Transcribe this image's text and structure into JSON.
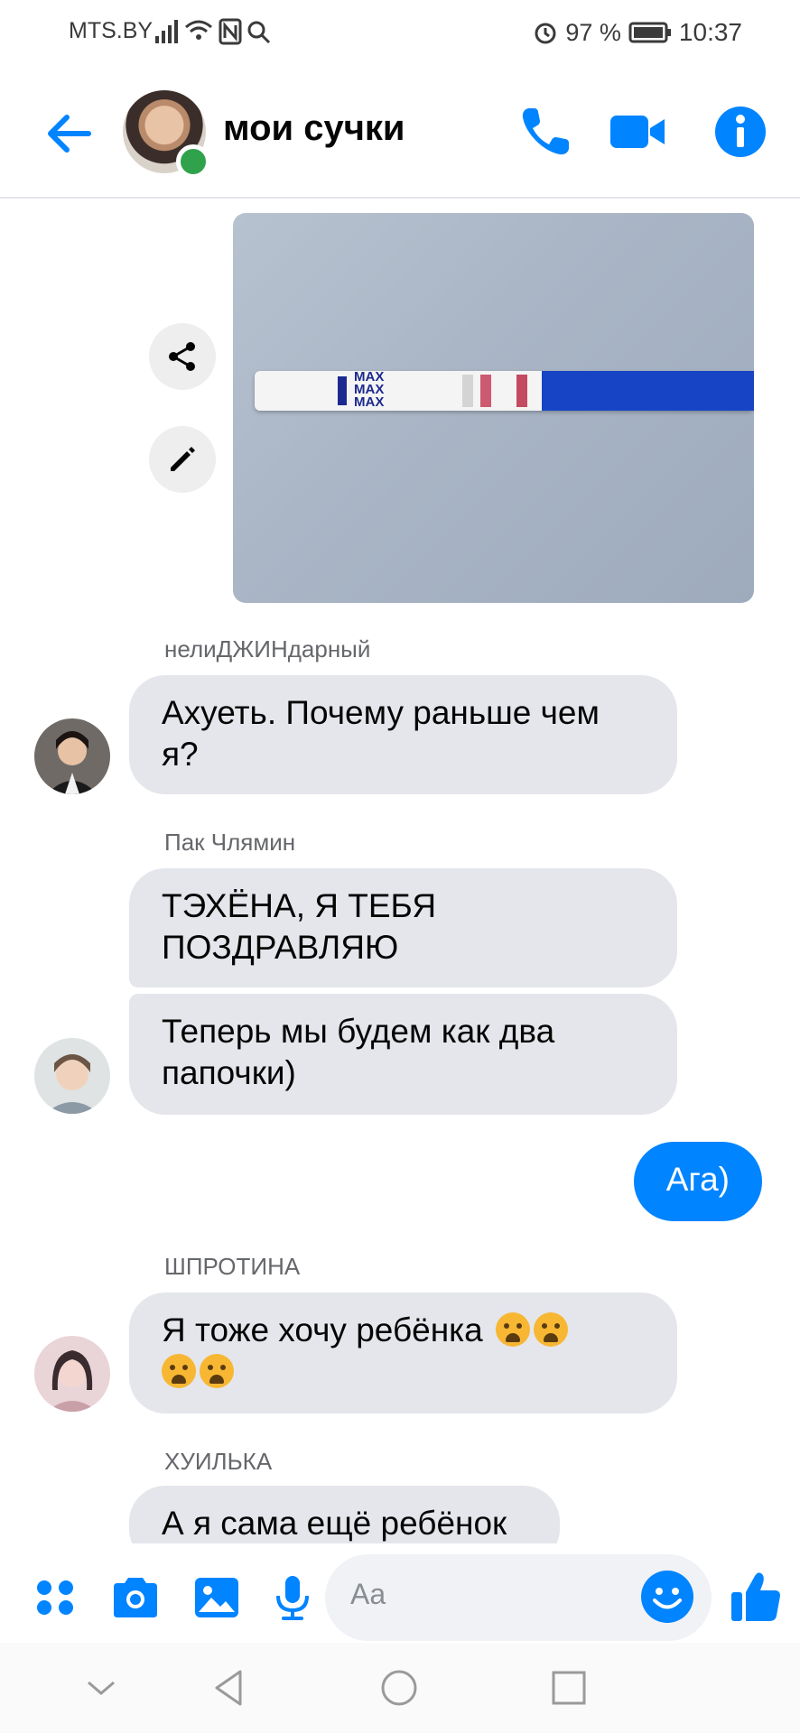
{
  "status_bar": {
    "carrier": "MTS.BY",
    "battery": "97 %",
    "time": "10:37"
  },
  "header": {
    "title": "мои сучки"
  },
  "messages": [
    {
      "sender": "нелиДЖИНдарный",
      "text": "Ахуеть. Почему раньше чем я?"
    },
    {
      "sender": "Пак Члямин",
      "text": "ТЭХЁНА, Я ТЕБЯ ПОЗДРАВЛЯЮ"
    },
    {
      "sender": "",
      "text": "Теперь мы будем как два папочки)"
    },
    {
      "sender": "me",
      "text": "Ага)"
    },
    {
      "sender": "ШПРОТИНА",
      "text": "Я тоже хочу ребёнка"
    },
    {
      "sender": "ХУИЛЬКА",
      "text": "А я сама ещё ребёнок"
    }
  ],
  "photo": {
    "strip_labels": [
      "MAX",
      "MAX",
      "MAX"
    ]
  },
  "composer": {
    "placeholder": "Aa"
  },
  "colors": {
    "accent": "#0084ff",
    "incoming_bubble": "#e4e6eb",
    "online": "#31a24c"
  },
  "icons": [
    "back-arrow-icon",
    "phone-icon",
    "video-icon",
    "info-icon",
    "share-icon",
    "edit-icon",
    "apps-icon",
    "camera-icon",
    "image-icon",
    "mic-icon",
    "emoji-icon",
    "thumbs-up-icon"
  ]
}
